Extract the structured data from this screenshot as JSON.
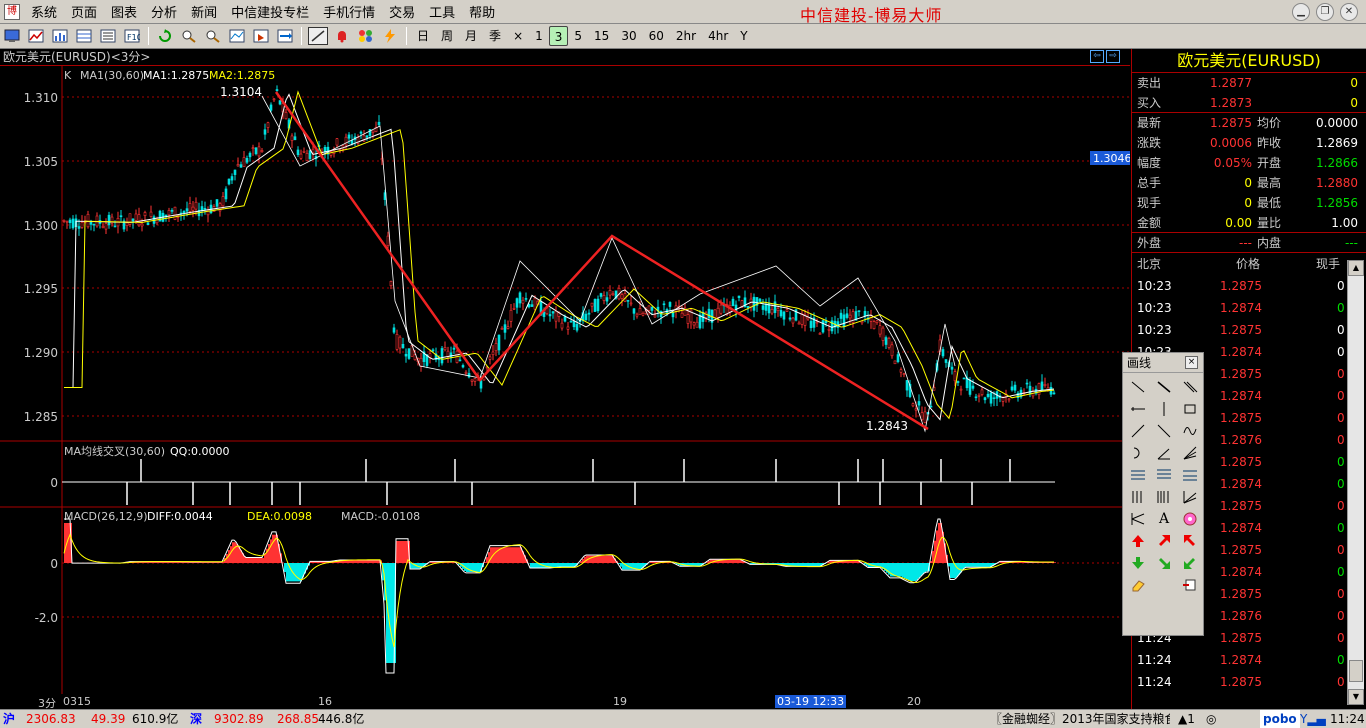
{
  "menu": {
    "items": [
      "系统",
      "页面",
      "图表",
      "分析",
      "新闻",
      "中信建投专栏",
      "手机行情",
      "交易",
      "工具",
      "帮助"
    ],
    "brand": "中信建投-博易大师"
  },
  "toolbar": {
    "periods": [
      "日",
      "周",
      "月",
      "季",
      "×",
      "1",
      "3",
      "5",
      "15",
      "30",
      "60",
      "2hr",
      "4hr",
      "Y"
    ],
    "active_period": "3"
  },
  "chart": {
    "title": "欧元美元(EURUSD)<3分>",
    "main_indicator": {
      "k_label": "K",
      "ma_label": "MA1(30,60)",
      "ma1": "MA1:1.2875",
      "ma2": "MA2:1.2875"
    },
    "y_ticks": [
      "1.310",
      "1.305",
      "1.300",
      "1.295",
      "1.290",
      "1.285"
    ],
    "high_label": "1.3104",
    "low_label": "1.2843",
    "price_marker": "1.3046",
    "cross_indicator": {
      "label": "MA均线交叉(30,60)",
      "qq": "QQ:0.0000",
      "zero": "0"
    },
    "macd_indicator": {
      "label": "MACD(26,12,9)",
      "diff": "DIFF:0.0044",
      "dea": "DEA:0.0098",
      "macd": "MACD:-0.0108",
      "zero": "0",
      "minus2": "-2.0"
    },
    "x_axis": {
      "period_label": "3分",
      "labels": [
        "0315",
        "16",
        "19",
        "20"
      ],
      "cursor": "03-19 12:33"
    }
  },
  "quote": {
    "title": "欧元美元(EURUSD)",
    "sell": {
      "label": "卖出",
      "price": "1.2877",
      "qty": "0"
    },
    "buy": {
      "label": "买入",
      "price": "1.2873",
      "qty": "0"
    },
    "rows": [
      {
        "l1": "最新",
        "v1": "1.2875",
        "c1": "red",
        "l2": "均价",
        "v2": "0.0000",
        "c2": "white"
      },
      {
        "l1": "涨跌",
        "v1": "0.0006",
        "c1": "red",
        "l2": "昨收",
        "v2": "1.2869",
        "c2": "white"
      },
      {
        "l1": "幅度",
        "v1": "0.05%",
        "c1": "red",
        "l2": "开盘",
        "v2": "1.2866",
        "c2": "green"
      },
      {
        "l1": "总手",
        "v1": "0",
        "c1": "yellow",
        "l2": "最高",
        "v2": "1.2880",
        "c2": "red"
      },
      {
        "l1": "现手",
        "v1": "0",
        "c1": "yellow",
        "l2": "最低",
        "v2": "1.2856",
        "c2": "green"
      },
      {
        "l1": "金额",
        "v1": "0.00",
        "c1": "yellow",
        "l2": "量比",
        "v2": "1.00",
        "c2": "white"
      }
    ],
    "outer": {
      "label": "外盘",
      "value": "---"
    },
    "inner": {
      "label": "内盘",
      "value": "---"
    },
    "tick_header": {
      "time": "北京",
      "price": "价格",
      "qty": "现手"
    },
    "ticks": [
      {
        "time": "10:23",
        "price": "1.2875",
        "qty": "0",
        "qc": "white"
      },
      {
        "time": "10:23",
        "price": "1.2874",
        "qty": "0",
        "qc": "green"
      },
      {
        "time": "10:23",
        "price": "1.2875",
        "qty": "0",
        "qc": "white"
      },
      {
        "time": "10:23",
        "price": "1.2874",
        "qty": "0",
        "qc": "white"
      },
      {
        "time": "10:23",
        "price": "1.2875",
        "qty": "0",
        "qc": "red"
      },
      {
        "time": "10:23",
        "price": "1.2874",
        "qty": "0",
        "qc": "red"
      },
      {
        "time": "10:23",
        "price": "1.2875",
        "qty": "0",
        "qc": "red"
      },
      {
        "time": "10:23",
        "price": "1.2876",
        "qty": "0",
        "qc": "red"
      },
      {
        "time": "10:23",
        "price": "1.2875",
        "qty": "0",
        "qc": "green"
      },
      {
        "time": "10:23",
        "price": "1.2874",
        "qty": "0",
        "qc": "green"
      },
      {
        "time": "10:23",
        "price": "1.2875",
        "qty": "0",
        "qc": "red"
      },
      {
        "time": "10:23",
        "price": "1.2874",
        "qty": "0",
        "qc": "green"
      },
      {
        "time": "10:23",
        "price": "1.2875",
        "qty": "0",
        "qc": "red"
      },
      {
        "time": "10:23",
        "price": "1.2874",
        "qty": "0",
        "qc": "green"
      },
      {
        "time": "10:23",
        "price": "1.2875",
        "qty": "0",
        "qc": "red"
      },
      {
        "time": "10:23",
        "price": "1.2876",
        "qty": "0",
        "qc": "red"
      },
      {
        "time": "11:24",
        "price": "1.2875",
        "qty": "0",
        "qc": "red"
      },
      {
        "time": "11:24",
        "price": "1.2874",
        "qty": "0",
        "qc": "green"
      },
      {
        "time": "11:24",
        "price": "1.2875",
        "qty": "0",
        "qc": "red"
      }
    ]
  },
  "draw_panel": {
    "title": "画线",
    "close": "×",
    "text_tool": "A"
  },
  "status": {
    "sh_label": "沪",
    "sh_index": "2306.83",
    "sh_change": "49.39",
    "sh_amount": "610.9亿",
    "sz_label": "深",
    "sz_index": "9302.89",
    "sz_change": "268.85",
    "sz_amount": "446.8亿",
    "news": "〖金融蜘经〗2013年国家支持粮食增",
    "alerts": "1",
    "brand": "pobo",
    "time": "11:24"
  }
}
